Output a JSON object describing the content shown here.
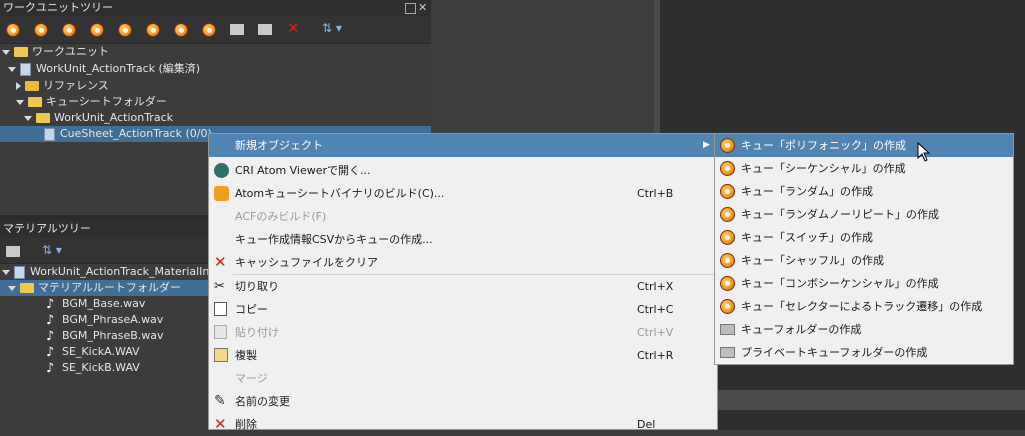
{
  "worktree": {
    "title": "ワークユニットツリー",
    "items": [
      {
        "label": "ワークユニット"
      },
      {
        "label": "WorkUnit_ActionTrack (編集済)"
      },
      {
        "label": "リファレンス"
      },
      {
        "label": "キューシートフォルダー"
      },
      {
        "label": "WorkUnit_ActionTrack"
      },
      {
        "label": "CueSheet_ActionTrack (0/0)"
      }
    ]
  },
  "materialtree": {
    "title": "マテリアルツリー",
    "items": [
      {
        "label": "WorkUnit_ActionTrack_MaterialInf"
      },
      {
        "label": "マテリアルルートフォルダー"
      },
      {
        "label": "BGM_Base.wav"
      },
      {
        "label": "BGM_PhraseA.wav"
      },
      {
        "label": "BGM_PhraseB.wav"
      },
      {
        "label": "SE_KickA.WAV"
      },
      {
        "label": "SE_KickB.WAV"
      }
    ]
  },
  "context_menu": {
    "items": [
      {
        "label": "新規オブジェクト",
        "shortcut": ""
      },
      {
        "label": "CRI Atom Viewerで開く...",
        "shortcut": ""
      },
      {
        "label": "Atomキューシートバイナリのビルド(C)...",
        "shortcut": "Ctrl+B"
      },
      {
        "label": "ACFのみビルド(F)",
        "shortcut": ""
      },
      {
        "label": "キュー作成情報CSVからキューの作成...",
        "shortcut": ""
      },
      {
        "label": "キャッシュファイルをクリア",
        "shortcut": ""
      },
      {
        "label": "切り取り",
        "shortcut": "Ctrl+X"
      },
      {
        "label": "コピー",
        "shortcut": "Ctrl+C"
      },
      {
        "label": "貼り付け",
        "shortcut": "Ctrl+V"
      },
      {
        "label": "複製",
        "shortcut": "Ctrl+R"
      },
      {
        "label": "マージ",
        "shortcut": ""
      },
      {
        "label": "名前の変更",
        "shortcut": ""
      },
      {
        "label": "削除",
        "shortcut": "Del"
      }
    ]
  },
  "submenu": {
    "items": [
      {
        "label": "キュー「ポリフォニック」の作成"
      },
      {
        "label": "キュー「シーケンシャル」の作成"
      },
      {
        "label": "キュー「ランダム」の作成"
      },
      {
        "label": "キュー「ランダムノーリピート」の作成"
      },
      {
        "label": "キュー「スイッチ」の作成"
      },
      {
        "label": "キュー「シャッフル」の作成"
      },
      {
        "label": "キュー「コンボシーケンシャル」の作成"
      },
      {
        "label": "キュー「セレクターによるトラック遷移」の作成"
      },
      {
        "label": "キューフォルダーの作成"
      },
      {
        "label": "プライベートキューフォルダーの作成"
      }
    ]
  },
  "colors": {
    "highlight": "#4f84b3",
    "selection": "#3f6f96",
    "panel": "#3c3c3c",
    "delete_red": "#d42020"
  }
}
